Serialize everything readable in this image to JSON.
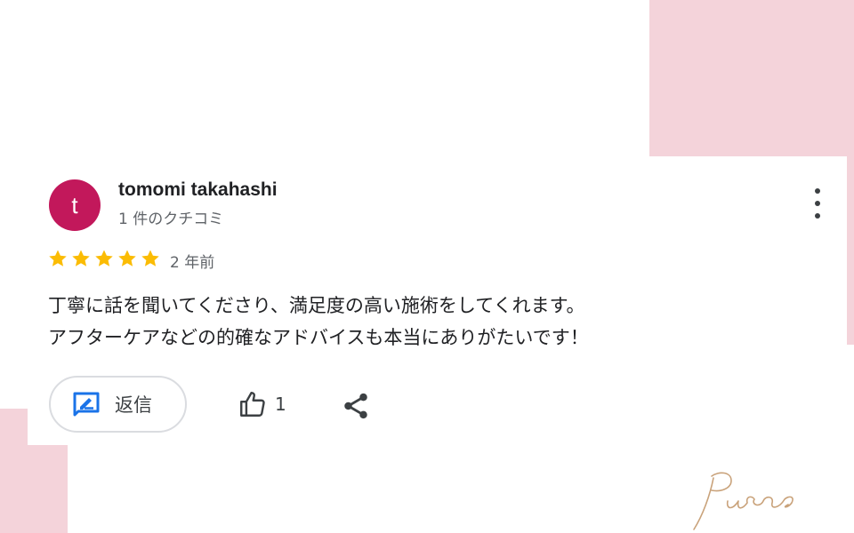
{
  "colors": {
    "accent_pink": "#f4d3da",
    "avatar_bg": "#c2185b",
    "star": "#fbbc04",
    "reply_icon": "#1a73e8",
    "logo_gold": "#c9a27a"
  },
  "review": {
    "avatar_letter": "t",
    "reviewer_name": "tomomi takahashi",
    "review_count": "1 件のクチコミ",
    "rating": 5,
    "time": "2 年前",
    "text_lines": [
      "丁寧に話を聞いてくださり、満足度の高い施術をしてくれます。",
      "アフターケアなどの的確なアドバイスも本当にありがたいです！"
    ]
  },
  "actions": {
    "reply_label": "返信",
    "reply_icon": "reply-edit-icon",
    "like_icon": "thumbs-up-icon",
    "like_count": "1",
    "share_icon": "share-icon",
    "more_icon": "more-vertical-icon"
  },
  "brand": {
    "logo_text": "Pure"
  }
}
